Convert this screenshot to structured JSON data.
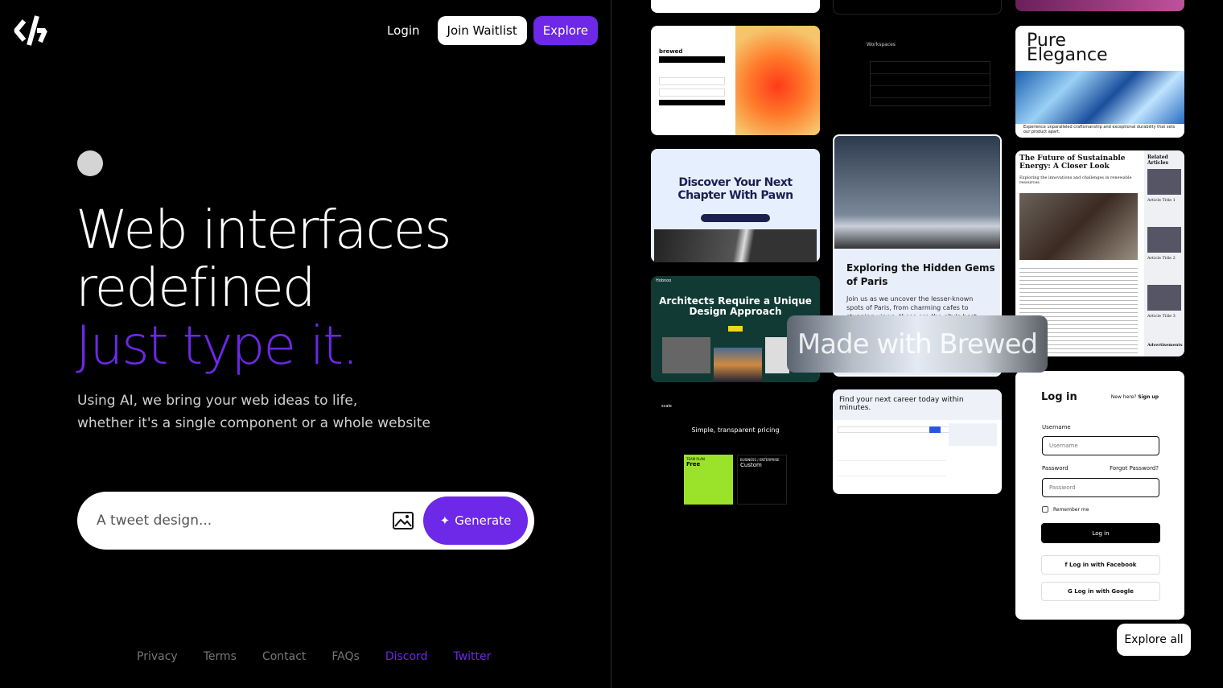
{
  "nav": {
    "login": "Login",
    "join": "Join Waitlist",
    "explore": "Explore"
  },
  "hero": {
    "line1": "Web interfaces",
    "line2": "redefined",
    "accent": "Just type it.",
    "sub1": "Using AI, we bring your web ideas to life,",
    "sub2": "whether it's a single component or a whole website"
  },
  "prompt": {
    "placeholder": "A tweet design...",
    "generate": "Generate"
  },
  "footer": [
    {
      "label": "Privacy"
    },
    {
      "label": "Terms"
    },
    {
      "label": "Contact"
    },
    {
      "label": "FAQs"
    },
    {
      "label": "Discord"
    },
    {
      "label": "Twitter"
    }
  ],
  "colors": {
    "accent": "#6d28e8",
    "background": "#000000"
  },
  "gallery": {
    "brewed": {
      "brand": "brewed"
    },
    "workspaces": {
      "title": "Workspaces"
    },
    "pure": {
      "title1": "Pure",
      "title2": "Elegance",
      "caption": "Experience unparalleled craftsmanship and exceptional durability that sets our product apart."
    },
    "pawn": {
      "title": "Discover Your Next Chapter With Pawn"
    },
    "paris": {
      "title": "Exploring the Hidden Gems of Paris",
      "body": "Join us as we uncover the lesser-known spots of Paris, from charming cafes to stunning views, these are the city's best kept secrets."
    },
    "energy": {
      "title": "The Future of Sustainable Energy: A Closer Look",
      "sub": "Exploring the innovations and challenges in renewable resources",
      "related": "Related Articles",
      "a1": "Article Title 1",
      "a2": "Article Title 2",
      "a3": "Article Title 3",
      "ads": "Advertisements"
    },
    "architects": {
      "title": "Architects Require a Unique Design Approach",
      "brand": "Hobnoo"
    },
    "pricing": {
      "brand": "scale",
      "title": "Simple, transparent pricing",
      "plan1": "TEAM PLAN",
      "price1": "Free",
      "plan2": "BUSINESS / ENTERPRISE",
      "price2": "Custom"
    },
    "career": {
      "title": "Find your next career today within minutes."
    },
    "login": {
      "title": "Log in",
      "new": "New here?",
      "signup": "Sign up",
      "username_label": "Username",
      "username_ph": "Username",
      "password_label": "Password",
      "forgot": "Forgot Password?",
      "password_ph": "Password",
      "remember": "Remember me",
      "submit": "Log in",
      "facebook": "Log in with Facebook",
      "google": "Log in with Google"
    }
  },
  "overlay": "Made with Brewed",
  "explore_all": "Explore all"
}
